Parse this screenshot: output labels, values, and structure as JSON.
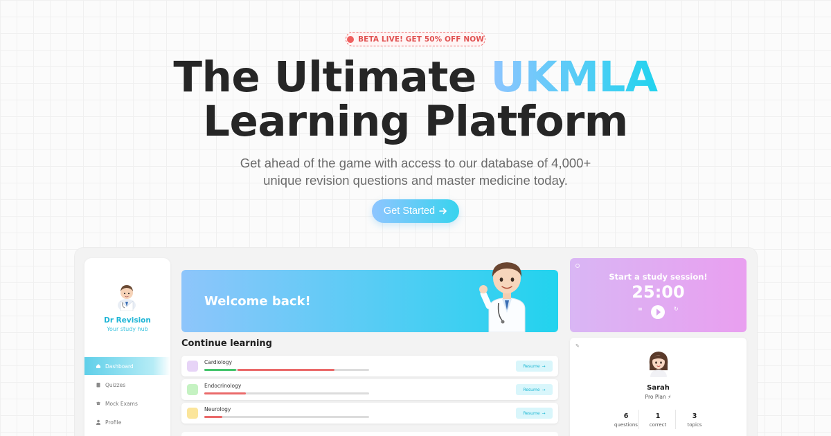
{
  "hero": {
    "badge": "BETA LIVE! GET 50% OFF NOW",
    "title_line1_part1": "The Ultimate ",
    "title_line1_accent": "UKMLA",
    "title_line2": "Learning Platform",
    "subtitle_line1": "Get ahead of the game with access to our database of 4,000+",
    "subtitle_line2": "unique revision questions and master medicine today.",
    "cta_label": "Get Started",
    "cta_icon": "arrow-right-icon"
  },
  "sidebar": {
    "brand_name": "Dr Revision",
    "brand_tagline": "Your study hub",
    "items": [
      {
        "label": "Dashboard",
        "icon": "home-icon",
        "active": true
      },
      {
        "label": "Quizzes",
        "icon": "clipboard-icon",
        "active": false
      },
      {
        "label": "Mock Exams",
        "icon": "graduation-cap-icon",
        "active": false
      },
      {
        "label": "Profile",
        "icon": "user-icon",
        "active": false
      }
    ]
  },
  "welcome": {
    "text": "Welcome back!"
  },
  "continue_learning": {
    "title": "Continue learning",
    "resume_label": "Resume",
    "courses": [
      {
        "name": "Cardiology",
        "swatch": "#e7d4f7",
        "progress_green": 0.2,
        "progress_red": 0.59
      },
      {
        "name": "Endocrinology",
        "swatch": "#c5f2c2",
        "progress_green": 0.0,
        "progress_red": 0.25
      },
      {
        "name": "Neurology",
        "swatch": "#fbe59b",
        "progress_green": 0.0,
        "progress_red": 0.11
      }
    ]
  },
  "timer": {
    "title": "Start a study session!",
    "value": "25:00",
    "left_icon": "list-icon",
    "right_icon": "reset-icon"
  },
  "profile": {
    "name": "Sarah",
    "plan": "Pro Plan ⚡",
    "stats": [
      {
        "value": "6",
        "label": "questions"
      },
      {
        "value": "1",
        "label": "correct"
      },
      {
        "value": "3",
        "label": "topics"
      }
    ]
  },
  "colors": {
    "accent_blue": "#8ec5ff",
    "accent_cyan": "#22d3ee",
    "timer_pink": "#e99ff0",
    "bar_green": "#44c46b",
    "bar_red": "#ea6a6a",
    "badge_red": "#ef5f5f"
  }
}
